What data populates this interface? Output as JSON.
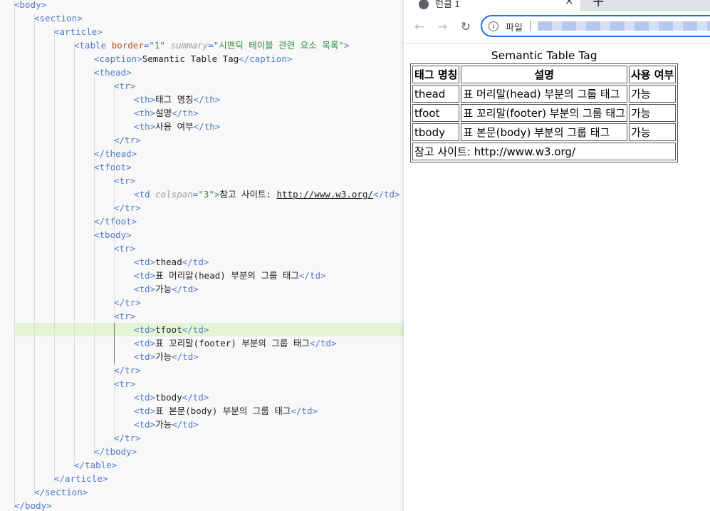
{
  "editor": {
    "lines": [
      {
        "indent": 0,
        "tokens": [
          {
            "c": "t",
            "v": "<body>"
          }
        ]
      },
      {
        "indent": 1,
        "tokens": [
          {
            "c": "t",
            "v": "<section>"
          }
        ]
      },
      {
        "indent": 2,
        "tokens": [
          {
            "c": "t",
            "v": "<article>"
          }
        ]
      },
      {
        "indent": 3,
        "tokens": [
          {
            "c": "t",
            "v": "<table "
          },
          {
            "c": "a",
            "v": "border"
          },
          {
            "c": "t",
            "v": "="
          },
          {
            "c": "s",
            "v": "\"1\""
          },
          {
            "c": "t",
            "v": " "
          },
          {
            "c": "ai",
            "v": "summary"
          },
          {
            "c": "t",
            "v": "="
          },
          {
            "c": "s",
            "v": "\"시맨틱 테이블 관련 요소 목록\""
          },
          {
            "c": "t",
            "v": ">"
          }
        ]
      },
      {
        "indent": 4,
        "tokens": [
          {
            "c": "t",
            "v": "<caption>"
          },
          {
            "c": "tx",
            "v": "Semantic Table Tag"
          },
          {
            "c": "t",
            "v": "</caption>"
          }
        ]
      },
      {
        "indent": 4,
        "tokens": [
          {
            "c": "t",
            "v": "<thead>"
          }
        ]
      },
      {
        "indent": 5,
        "tokens": [
          {
            "c": "t",
            "v": "<tr>"
          }
        ]
      },
      {
        "indent": 6,
        "tokens": [
          {
            "c": "t",
            "v": "<th>"
          },
          {
            "c": "tx",
            "v": "태그 명칭"
          },
          {
            "c": "t",
            "v": "</th>"
          }
        ]
      },
      {
        "indent": 6,
        "tokens": [
          {
            "c": "t",
            "v": "<th>"
          },
          {
            "c": "tx",
            "v": "설명"
          },
          {
            "c": "t",
            "v": "</th>"
          }
        ]
      },
      {
        "indent": 6,
        "tokens": [
          {
            "c": "t",
            "v": "<th>"
          },
          {
            "c": "tx",
            "v": "사용 여부"
          },
          {
            "c": "t",
            "v": "</th>"
          }
        ]
      },
      {
        "indent": 5,
        "tokens": [
          {
            "c": "t",
            "v": "</tr>"
          }
        ]
      },
      {
        "indent": 4,
        "tokens": [
          {
            "c": "t",
            "v": "</thead>"
          }
        ]
      },
      {
        "indent": 4,
        "tokens": [
          {
            "c": "t",
            "v": "<tfoot>"
          }
        ]
      },
      {
        "indent": 5,
        "tokens": [
          {
            "c": "t",
            "v": "<tr>"
          }
        ]
      },
      {
        "indent": 6,
        "tokens": [
          {
            "c": "t",
            "v": "<td "
          },
          {
            "c": "ai",
            "v": "colspan"
          },
          {
            "c": "t",
            "v": "="
          },
          {
            "c": "s",
            "v": "\"3\""
          },
          {
            "c": "t",
            "v": ">"
          },
          {
            "c": "tx",
            "v": "참고 사이트: "
          },
          {
            "c": "ln",
            "v": "http://www.w3.org/"
          },
          {
            "c": "t",
            "v": "</td>"
          }
        ]
      },
      {
        "indent": 5,
        "tokens": [
          {
            "c": "t",
            "v": "</tr>"
          }
        ]
      },
      {
        "indent": 4,
        "tokens": [
          {
            "c": "t",
            "v": "</tfoot>"
          }
        ]
      },
      {
        "indent": 4,
        "tokens": [
          {
            "c": "t",
            "v": "<tbody>"
          }
        ]
      },
      {
        "indent": 5,
        "tokens": [
          {
            "c": "t",
            "v": "<tr>"
          }
        ]
      },
      {
        "indent": 6,
        "tokens": [
          {
            "c": "t",
            "v": "<td>"
          },
          {
            "c": "tx",
            "v": "thead"
          },
          {
            "c": "t",
            "v": "</td>"
          }
        ]
      },
      {
        "indent": 6,
        "tokens": [
          {
            "c": "t",
            "v": "<td>"
          },
          {
            "c": "tx",
            "v": "표 머리말(head) 부분의 그룹 태그"
          },
          {
            "c": "t",
            "v": "</td>"
          }
        ]
      },
      {
        "indent": 6,
        "tokens": [
          {
            "c": "t",
            "v": "<td>"
          },
          {
            "c": "tx",
            "v": "가능"
          },
          {
            "c": "t",
            "v": "</td>"
          }
        ]
      },
      {
        "indent": 5,
        "tokens": [
          {
            "c": "t",
            "v": "</tr>"
          }
        ]
      },
      {
        "indent": 5,
        "tokens": [
          {
            "c": "t",
            "v": "<tr>"
          }
        ]
      },
      {
        "indent": 6,
        "tokens": [
          {
            "c": "t",
            "v": "<td>"
          },
          {
            "c": "tx",
            "v": "tfoot"
          },
          {
            "c": "t",
            "v": "</td>"
          }
        ]
      },
      {
        "indent": 6,
        "tokens": [
          {
            "c": "t",
            "v": "<td>"
          },
          {
            "c": "tx",
            "v": "표 꼬리말(footer) 부분의 그룹 태그"
          },
          {
            "c": "t",
            "v": "</td>"
          }
        ]
      },
      {
        "indent": 6,
        "tokens": [
          {
            "c": "t",
            "v": "<td>"
          },
          {
            "c": "tx",
            "v": "가능"
          },
          {
            "c": "t",
            "v": "</td>"
          }
        ]
      },
      {
        "indent": 5,
        "tokens": [
          {
            "c": "t",
            "v": "</tr>"
          }
        ]
      },
      {
        "indent": 5,
        "tokens": [
          {
            "c": "t",
            "v": "<tr>"
          }
        ]
      },
      {
        "indent": 6,
        "tokens": [
          {
            "c": "t",
            "v": "<td>"
          },
          {
            "c": "tx",
            "v": "tbody"
          },
          {
            "c": "t",
            "v": "</td>"
          }
        ]
      },
      {
        "indent": 6,
        "tokens": [
          {
            "c": "t",
            "v": "<td>"
          },
          {
            "c": "tx",
            "v": "표 본문(body) 부분의 그룹 태그"
          },
          {
            "c": "t",
            "v": "</td>"
          }
        ]
      },
      {
        "indent": 6,
        "tokens": [
          {
            "c": "t",
            "v": "<td>"
          },
          {
            "c": "tx",
            "v": "가능"
          },
          {
            "c": "t",
            "v": "</td>"
          }
        ]
      },
      {
        "indent": 5,
        "tokens": [
          {
            "c": "t",
            "v": "</tr>"
          }
        ]
      },
      {
        "indent": 4,
        "tokens": [
          {
            "c": "t",
            "v": "</tbody>"
          }
        ]
      },
      {
        "indent": 3,
        "tokens": [
          {
            "c": "t",
            "v": "</table>"
          }
        ]
      },
      {
        "indent": 2,
        "tokens": [
          {
            "c": "t",
            "v": "</article>"
          }
        ]
      },
      {
        "indent": 1,
        "tokens": [
          {
            "c": "t",
            "v": "</section>"
          }
        ]
      },
      {
        "indent": 0,
        "tokens": [
          {
            "c": "t",
            "v": "</body>"
          }
        ]
      }
    ],
    "highlighted_line": 24,
    "colors": {
      "tag": "#4f7ac7",
      "attr": "#b7522a",
      "string": "#2f8f3a",
      "highlight": "#e4f5d6"
    }
  },
  "browser": {
    "tab_title": "런클 1",
    "tab_close": "×",
    "new_tab": "+",
    "back": "←",
    "forward": "→",
    "reload": "↻",
    "info_icon": "i",
    "scheme_label": "파일",
    "accent": "#1a73e8"
  },
  "table": {
    "caption": "Semantic Table Tag",
    "headers": [
      "태그 명칭",
      "설명",
      "사용 여부"
    ],
    "rows": [
      [
        "thead",
        "표 머리말(head) 부분의 그룹 태그",
        "가능"
      ],
      [
        "tfoot",
        "표 꼬리말(footer) 부분의 그룹 태그",
        "가능"
      ],
      [
        "tbody",
        "표 본문(body) 부분의 그룹 태그",
        "가능"
      ]
    ],
    "footer": "참고 사이트: http://www.w3.org/"
  }
}
